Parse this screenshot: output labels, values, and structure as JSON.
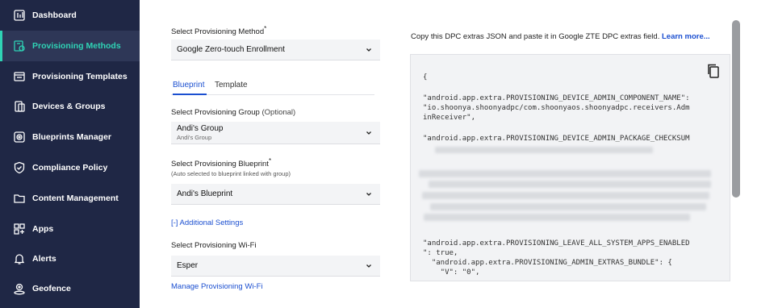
{
  "sidebar": {
    "items": [
      {
        "label": "Dashboard",
        "icon": "dashboard-icon"
      },
      {
        "label": "Provisioning Methods",
        "icon": "provisioning-methods-icon",
        "active": true
      },
      {
        "label": "Provisioning Templates",
        "icon": "provisioning-templates-icon"
      },
      {
        "label": "Devices & Groups",
        "icon": "devices-icon"
      },
      {
        "label": "Blueprints Manager",
        "icon": "blueprints-icon"
      },
      {
        "label": "Compliance Policy",
        "icon": "shield-icon"
      },
      {
        "label": "Content Management",
        "icon": "folder-icon"
      },
      {
        "label": "Apps",
        "icon": "apps-icon"
      },
      {
        "label": "Alerts",
        "icon": "bell-icon"
      },
      {
        "label": "Geofence",
        "icon": "geofence-icon"
      }
    ]
  },
  "form": {
    "method_label": "Select Provisioning Method",
    "method_required": "*",
    "method_value": "Google Zero-touch Enrollment",
    "tabs": [
      "Blueprint",
      "Template"
    ],
    "group_label": "Select Provisioning Group",
    "group_optional": "(Optional)",
    "group_value": "Andi's Group",
    "group_sub": "Andi's Group",
    "blueprint_label": "Select Provisioning Blueprint",
    "blueprint_required": "*",
    "blueprint_hint": "(Auto selected to blueprint linked with group)",
    "blueprint_value": "Andi's Blueprint",
    "additional_settings": "[-] Additional Settings",
    "wifi_label": "Select Provisioning Wi-Fi",
    "wifi_value": "Esper",
    "manage_wifi": "Manage Provisioning Wi-Fi"
  },
  "info": {
    "text": "Copy this DPC extras JSON and paste it in Google ZTE DPC extras field.",
    "learn_more": "Learn more..."
  },
  "code": {
    "line_open": "{",
    "component_1": "\"android.app.extra.PROVISIONING_DEVICE_ADMIN_COMPONENT_NAME\":",
    "component_2": "\"io.shoonya.shoonyadpc/com.shoonyaos.shoonyadpc.receivers.Adm",
    "component_3": "inReceiver\",",
    "checksum_1": "\"android.app.extra.PROVISIONING_DEVICE_ADMIN_PACKAGE_CHECKSUM",
    "leave_1": "\"android.app.extra.PROVISIONING_LEAVE_ALL_SYSTEM_APPS_ENABLED",
    "leave_2": "\": true,",
    "bundle": "  \"android.app.extra.PROVISIONING_ADMIN_EXTRAS_BUNDLE\": {",
    "v_line": "    \"V\": \"0\","
  },
  "colors": {
    "sidebar_bg": "#1f2745",
    "accent": "#2fd3b5",
    "link": "#1b4fd0"
  }
}
